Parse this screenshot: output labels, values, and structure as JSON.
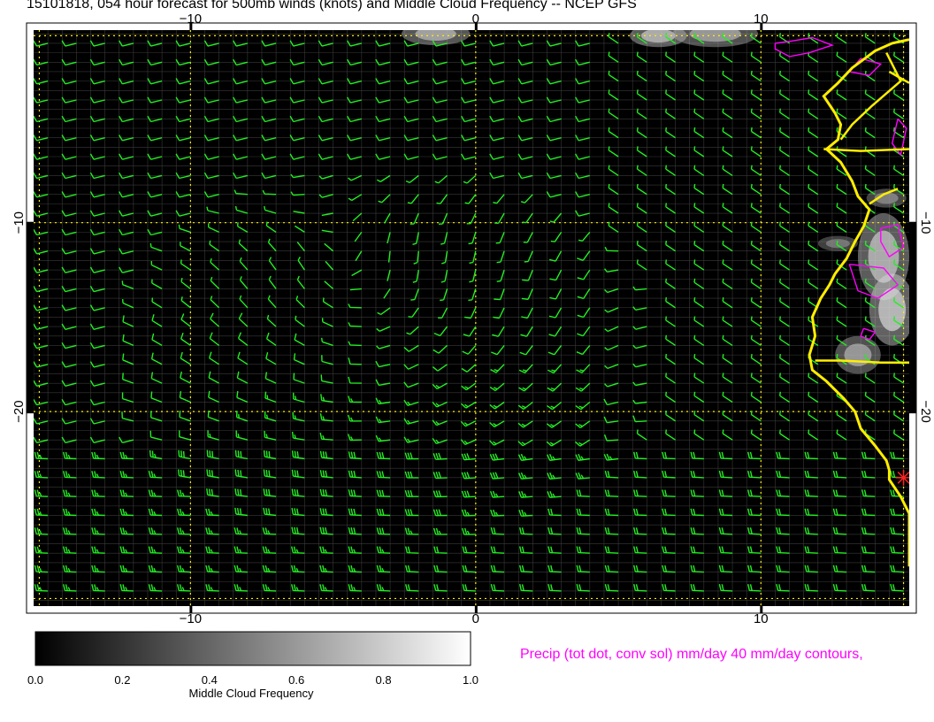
{
  "title": "15101818, 054 hour forecast for 500mb winds (knots) and Middle Cloud Frequency -- NCEP GFS",
  "map": {
    "lon_range": [
      -15.5,
      15.2
    ],
    "lat_range": [
      -30.3,
      0.2
    ],
    "x_ticks": [
      {
        "value": -10,
        "label": "−10"
      },
      {
        "value": 0,
        "label": "0"
      },
      {
        "value": 10,
        "label": "10"
      }
    ],
    "y_ticks": [
      {
        "value": -10,
        "label": "−10"
      },
      {
        "value": -20,
        "label": "−20"
      }
    ],
    "reference_lines_lon": [
      -15.3,
      -10,
      0,
      10,
      15
    ],
    "reference_lines_lat": [
      -0.1,
      -10,
      -20,
      -29.9
    ],
    "colors": {
      "background": "#000000",
      "wind_barbs": "#22ee22",
      "coastline": "#ffee00",
      "precip_contours": "#ff00ff",
      "reference_lines": "#ffee00",
      "grid": "#3a3a3a",
      "marker": "#ff2222"
    },
    "wind_barbs": {
      "units": "knots",
      "grid_lon_start": -15,
      "grid_lon_step": 1,
      "grid_lat_start": -29.5,
      "grid_lat_step": 1
    },
    "coastline": [
      [
        15.2,
        -0.3
      ],
      [
        14.6,
        -0.5
      ],
      [
        14.0,
        -0.9
      ],
      [
        13.2,
        -1.8
      ],
      [
        12.7,
        -2.6
      ],
      [
        12.2,
        -3.3
      ],
      [
        12.6,
        -4.2
      ],
      [
        12.8,
        -4.8
      ],
      [
        12.7,
        -5.6
      ],
      [
        12.3,
        -6.1
      ],
      [
        12.8,
        -6.8
      ],
      [
        13.2,
        -7.8
      ],
      [
        13.4,
        -8.6
      ],
      [
        13.8,
        -9.3
      ],
      [
        13.6,
        -10.2
      ],
      [
        13.3,
        -11.0
      ],
      [
        13.0,
        -11.9
      ],
      [
        12.6,
        -12.7
      ],
      [
        12.4,
        -13.3
      ],
      [
        12.1,
        -14.0
      ],
      [
        11.8,
        -15.0
      ],
      [
        11.9,
        -16.0
      ],
      [
        11.7,
        -17.0
      ],
      [
        11.8,
        -17.8
      ],
      [
        12.3,
        -18.4
      ],
      [
        12.9,
        -19.3
      ],
      [
        13.3,
        -20.0
      ],
      [
        13.5,
        -20.9
      ],
      [
        14.0,
        -21.8
      ],
      [
        14.4,
        -22.6
      ],
      [
        14.5,
        -23.1
      ],
      [
        14.5,
        -23.6
      ],
      [
        14.9,
        -24.5
      ],
      [
        15.2,
        -25.4
      ],
      [
        15.2,
        -27.3
      ],
      [
        15.2,
        -28.2
      ]
    ],
    "borders": [
      [
        [
          14.4,
          -1.0
        ],
        [
          14.9,
          -2.5
        ],
        [
          13.9,
          -3.8
        ],
        [
          13.2,
          -4.8
        ],
        [
          12.8,
          -5.6
        ]
      ],
      [
        [
          11.9,
          -17.3
        ],
        [
          12.8,
          -17.3
        ],
        [
          14.2,
          -17.4
        ],
        [
          15.2,
          -17.4
        ]
      ],
      [
        [
          12.2,
          -6.1
        ],
        [
          13.5,
          -6.2
        ],
        [
          15.2,
          -6.1
        ]
      ],
      [
        [
          13.8,
          -9.0
        ],
        [
          14.3,
          -8.5
        ],
        [
          14.8,
          -8.2
        ]
      ],
      [
        [
          14.5,
          -2.0
        ],
        [
          15.2,
          -2.6
        ]
      ]
    ],
    "precip_contours": [
      [
        [
          10.5,
          -0.5
        ],
        [
          11.0,
          -0.4
        ],
        [
          11.8,
          -0.2
        ],
        [
          12.5,
          -0.6
        ],
        [
          11.7,
          -1.0
        ],
        [
          11.0,
          -1.2
        ],
        [
          10.5,
          -0.8
        ],
        [
          10.5,
          -0.5
        ]
      ],
      [
        [
          13.5,
          -1.3
        ],
        [
          14.2,
          -1.6
        ],
        [
          13.8,
          -2.2
        ],
        [
          13.1,
          -2.0
        ],
        [
          13.5,
          -1.3
        ]
      ],
      [
        [
          14.8,
          -4.5
        ],
        [
          15.1,
          -5.0
        ],
        [
          14.9,
          -6.4
        ],
        [
          14.6,
          -5.8
        ],
        [
          14.8,
          -4.5
        ]
      ],
      [
        [
          14.2,
          -10.3
        ],
        [
          14.8,
          -10.1
        ],
        [
          15.0,
          -11.3
        ],
        [
          14.5,
          -11.8
        ],
        [
          14.2,
          -11.0
        ],
        [
          14.2,
          -10.3
        ]
      ],
      [
        [
          13.1,
          -12.2
        ],
        [
          14.3,
          -12.4
        ],
        [
          14.8,
          -13.3
        ],
        [
          14.1,
          -14.0
        ],
        [
          13.4,
          -13.6
        ],
        [
          13.1,
          -12.2
        ]
      ],
      [
        [
          13.6,
          -15.6
        ],
        [
          14.0,
          -15.8
        ],
        [
          13.8,
          -16.2
        ],
        [
          13.5,
          -16.0
        ],
        [
          13.6,
          -15.6
        ]
      ]
    ],
    "cloud_patches": [
      {
        "lon": -1.4,
        "lat": 0.0,
        "rx": 1.2,
        "ry": 0.6,
        "value": 0.75
      },
      {
        "lon": 6.4,
        "lat": -0.1,
        "rx": 1.0,
        "ry": 0.6,
        "value": 0.8
      },
      {
        "lon": 8.4,
        "lat": 0.0,
        "rx": 1.5,
        "ry": 0.7,
        "value": 0.7
      },
      {
        "lon": 14.3,
        "lat": -11.8,
        "rx": 0.9,
        "ry": 2.3,
        "value": 0.8
      },
      {
        "lon": 14.6,
        "lat": -14.6,
        "rx": 0.8,
        "ry": 1.9,
        "value": 0.85
      },
      {
        "lon": 13.4,
        "lat": -17.0,
        "rx": 0.8,
        "ry": 1.0,
        "value": 0.7
      },
      {
        "lon": 14.4,
        "lat": -8.7,
        "rx": 0.7,
        "ry": 0.5,
        "value": 0.6
      },
      {
        "lon": 12.7,
        "lat": -11.1,
        "rx": 0.7,
        "ry": 0.4,
        "value": 0.55
      }
    ],
    "markers": [
      {
        "lon": 15.0,
        "lat": -23.5,
        "symbol": "star"
      }
    ]
  },
  "colorbar": {
    "title": "Middle Cloud Frequency",
    "min": 0.0,
    "max": 1.0,
    "ticks": [
      {
        "value": 0.0,
        "label": "0.0"
      },
      {
        "value": 0.2,
        "label": "0.2"
      },
      {
        "value": 0.4,
        "label": "0.4"
      },
      {
        "value": 0.6,
        "label": "0.6"
      },
      {
        "value": 0.8,
        "label": "0.8"
      },
      {
        "value": 1.0,
        "label": "1.0"
      }
    ]
  },
  "precip_note": {
    "text": "Precip (tot dot, conv sol) mm/day 40 mm/day contours,",
    "color": "#ff00ff"
  }
}
